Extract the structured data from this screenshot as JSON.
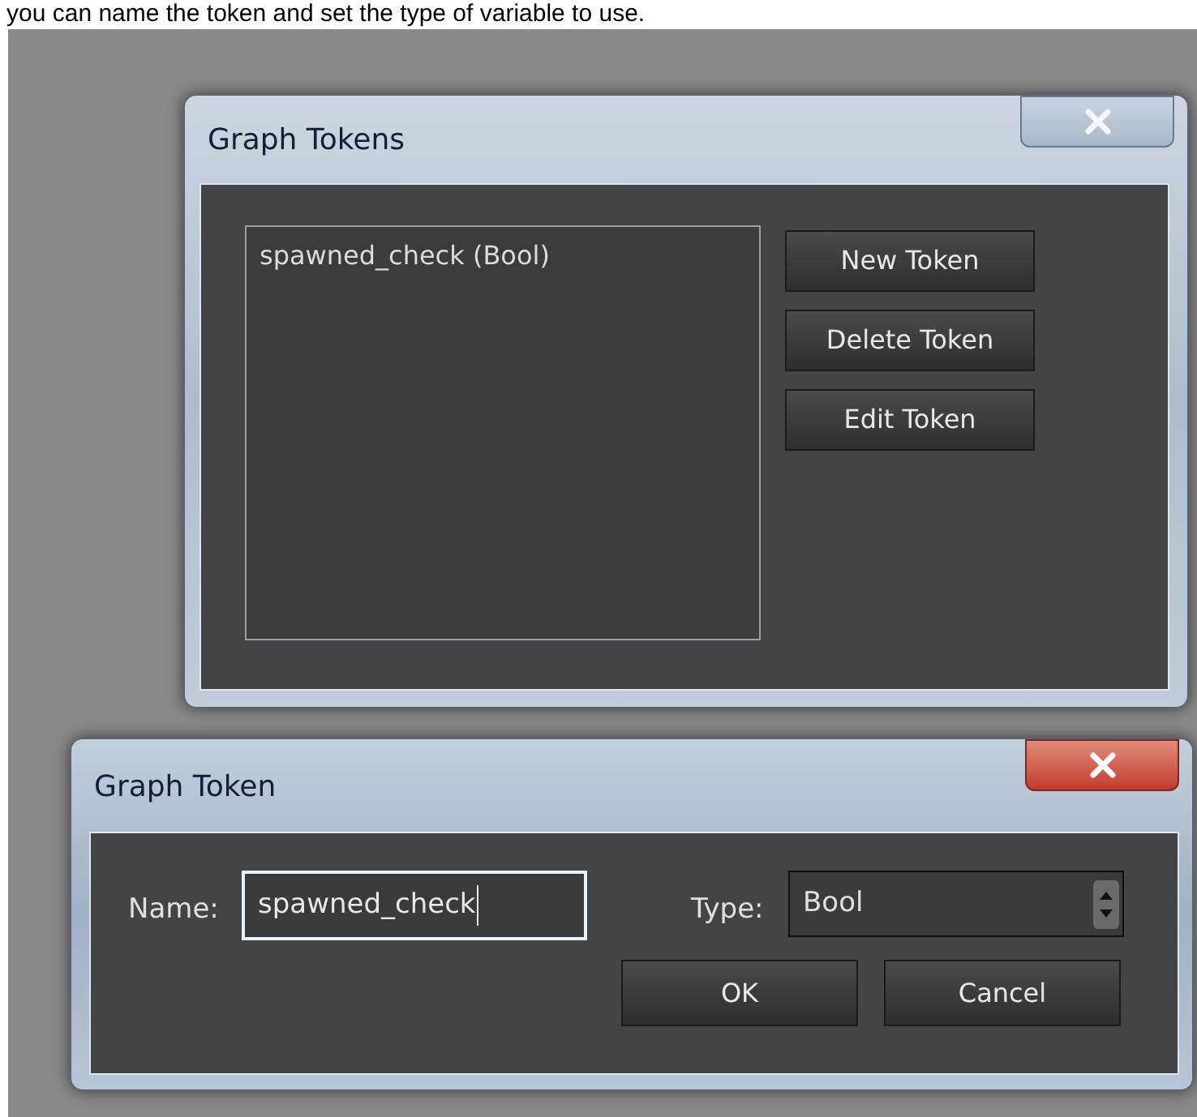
{
  "caption": "you can name the token and set the type of variable to use.",
  "tokens_dialog": {
    "title": "Graph Tokens",
    "active": false,
    "tokens": [
      {
        "label": "spawned_check (Bool)",
        "selected": false
      }
    ],
    "buttons": [
      "New Token",
      "Delete Token",
      "Edit Token"
    ]
  },
  "token_dialog": {
    "title": "Graph Token",
    "active": true,
    "name_label": "Name:",
    "name_value": "spawned_check",
    "type_label": "Type:",
    "type_value": "Bool",
    "buttons": [
      "OK",
      "Cancel"
    ]
  }
}
